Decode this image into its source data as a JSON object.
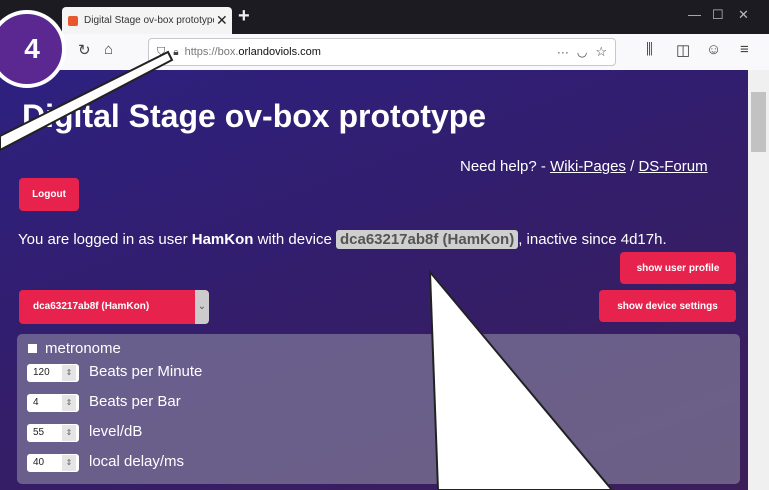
{
  "browser": {
    "tab_title": "Digital Stage ov-box prototype",
    "url_prefix": "https://box.",
    "url_domain": "orlandoviols.com"
  },
  "page": {
    "heading": "Digital Stage ov-box prototype",
    "help_prefix": "Need help? - ",
    "help_link1": "Wiki-Pages",
    "help_sep": " / ",
    "help_link2": "DS-Forum",
    "logout_label": "Logout",
    "logged_in_prefix": "You are logged in as user ",
    "username": "HamKon",
    "with_device": " with device ",
    "device_badge": "dca63217ab8f (HamKon)",
    "inactive_text": ", inactive since 4d17h.",
    "show_profile_label": "show user profile",
    "show_device_settings_label": "show device settings",
    "device_select_value": "dca63217ab8f (HamKon)",
    "metronome_label": "metronome",
    "fields": [
      {
        "value": "120",
        "label": "Beats per Minute"
      },
      {
        "value": "4",
        "label": "Beats per Bar"
      },
      {
        "value": "55",
        "label": "level/dB"
      },
      {
        "value": "40",
        "label": "local delay/ms"
      }
    ]
  },
  "annotation": {
    "step_number": "4"
  },
  "colors": {
    "accent": "#e6224d",
    "page_bg": "#2d2080",
    "annotation": "#5a2890"
  }
}
